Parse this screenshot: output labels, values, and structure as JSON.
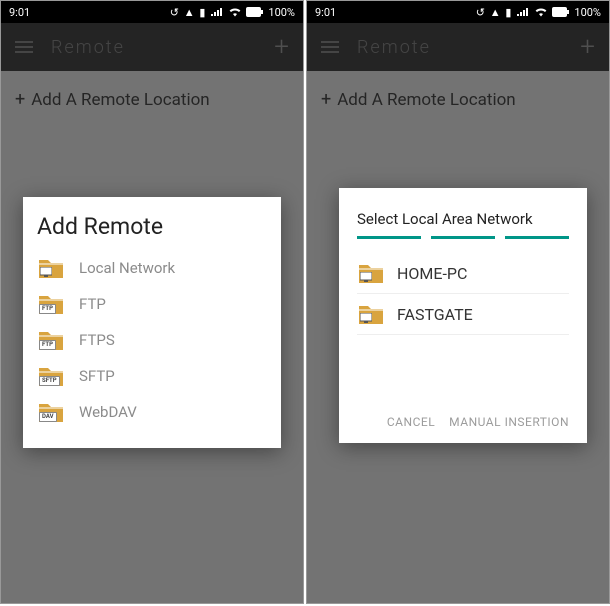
{
  "status": {
    "time": "9:01",
    "battery": "100%"
  },
  "appbar": {
    "title": "Remote",
    "add_icon": "+"
  },
  "content": {
    "add_location_label": "Add A Remote Location",
    "plus": "+"
  },
  "dialog_left": {
    "title": "Add Remote",
    "items": [
      {
        "label": "Local Network",
        "badge_type": "monitor"
      },
      {
        "label": "FTP",
        "badge_type": "text",
        "badge": "FTP"
      },
      {
        "label": "FTPS",
        "badge_type": "text",
        "badge": "FTP"
      },
      {
        "label": "SFTP",
        "badge_type": "text",
        "badge": "SFTP"
      },
      {
        "label": "WebDAV",
        "badge_type": "text",
        "badge": "DAV"
      }
    ]
  },
  "dialog_right": {
    "title": "Select Local Area Network",
    "items": [
      {
        "label": "HOME-PC"
      },
      {
        "label": "FASTGATE"
      }
    ],
    "cancel": "CANCEL",
    "manual": "MANUAL INSERTION"
  }
}
